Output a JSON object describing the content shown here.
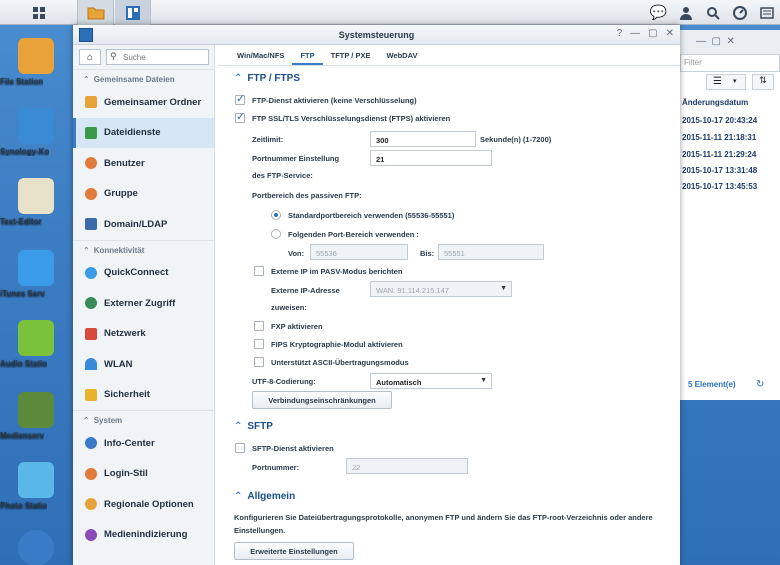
{
  "desktop": {
    "icons": [
      {
        "label": "File Station",
        "color": "#e8a23a"
      },
      {
        "label": "Synology-Ko",
        "color": "#3a8bd6"
      },
      {
        "label": "Text-Editor",
        "color": "#e8e2c8"
      },
      {
        "label": "iTunes Serv",
        "color": "#3a9be8"
      },
      {
        "label": "Audio Statio",
        "color": "#7ac23a"
      },
      {
        "label": "Medienserv",
        "color": "#5a8a3a"
      },
      {
        "label": "Photo Statio",
        "color": "#5ab8e8"
      },
      {
        "label": "",
        "color": "#3a7bc8"
      }
    ]
  },
  "file_station": {
    "filter_placeholder": "Filter",
    "column_header": "Änderungsdatum",
    "rows": [
      "2015-10-17 20:43:24",
      "2015-11-11 21:18:31",
      "2015-11-11 21:29:24",
      "2015-10-17 13:31:48",
      "2015-10-17 13:45:53"
    ],
    "footer": "5 Element(e)"
  },
  "window": {
    "title": "Systemsteuerung",
    "search_placeholder": "Suche"
  },
  "sidebar": {
    "sections": [
      {
        "title": "Gemeinsame Dateien",
        "items": [
          {
            "label": "Gemeinsamer Ordner",
            "icon": "folder-share-icon",
            "color": "#e8a23a"
          },
          {
            "label": "Dateidienste",
            "icon": "file-services-icon",
            "color": "#3a9a4a"
          },
          {
            "label": "Benutzer",
            "icon": "user-icon",
            "color": "#e07a3a"
          },
          {
            "label": "Gruppe",
            "icon": "group-icon",
            "color": "#e07a3a"
          },
          {
            "label": "Domain/LDAP",
            "icon": "domain-icon",
            "color": "#3a6aa8"
          }
        ]
      },
      {
        "title": "Konnektivität",
        "items": [
          {
            "label": "QuickConnect",
            "icon": "quickconnect-icon",
            "color": "#3a9be8"
          },
          {
            "label": "Externer Zugriff",
            "icon": "globe-icon",
            "color": "#3a8a5a"
          },
          {
            "label": "Netzwerk",
            "icon": "network-icon",
            "color": "#d84a3a"
          },
          {
            "label": "WLAN",
            "icon": "wifi-icon",
            "color": "#3a8ad8"
          },
          {
            "label": "Sicherheit",
            "icon": "shield-icon",
            "color": "#e8b22a"
          }
        ]
      },
      {
        "title": "System",
        "items": [
          {
            "label": "Info-Center",
            "icon": "info-icon",
            "color": "#3a7bc8"
          },
          {
            "label": "Login-Stil",
            "icon": "palette-icon",
            "color": "#e07a3a"
          },
          {
            "label": "Regionale Optionen",
            "icon": "regional-icon",
            "color": "#e8a23a"
          },
          {
            "label": "Medienindizierung",
            "icon": "media-index-icon",
            "color": "#8a4ab8"
          }
        ]
      }
    ],
    "selected": "Dateidienste"
  },
  "tabs": [
    "Win/Mac/NFS",
    "FTP",
    "TFTP / PXE",
    "WebDAV"
  ],
  "active_tab": "FTP",
  "ftp": {
    "heading": "FTP / FTPS",
    "enable_ftp": "FTP-Dienst aktivieren (keine Verschlüsselung)",
    "enable_ftps": "FTP SSL/TLS Verschlüsselungsdienst (FTPS) aktivieren",
    "timeout_label": "Zeitlimit:",
    "timeout_value": "300",
    "timeout_unit": "Sekunde(n) (1-7200)",
    "port_label_1": "Portnummer Einstellung",
    "port_label_2": "des FTP-Service:",
    "port_value": "21",
    "passive_label": "Portbereich des passiven FTP:",
    "passive_default": "Standardportbereich verwenden (55536-55551)",
    "passive_custom": "Folgenden Port-Bereich verwenden :",
    "from_label": "Von:",
    "from_value": "55536",
    "to_label": "Bis:",
    "to_value": "55551",
    "report_ext_ip": "Externe IP im PASV-Modus berichten",
    "ext_ip_label_1": "Externe IP-Adresse",
    "ext_ip_label_2": "zuweisen:",
    "ext_ip_value": "WAN: 91.114.215.147",
    "fxp": "FXP aktivieren",
    "fips": "FIPS Kryptographie-Modul aktivieren",
    "ascii": "Unterstützt ASCII-Übertragungsmodus",
    "utf8_label": "UTF-8-Codierung:",
    "utf8_value": "Automatisch",
    "conn_limits_button": "Verbindungseinschränkungen"
  },
  "sftp": {
    "heading": "SFTP",
    "enable": "SFTP-Dienst aktivieren",
    "port_label": "Portnummer:",
    "port_value": "22"
  },
  "general": {
    "heading": "Allgemein",
    "text": "Konfigurieren Sie Dateiübertragungsprotokolle, anonymen FTP und ändern Sie das FTP-root-Verzeichnis oder andere Einstellungen.",
    "advanced_button": "Erweiterte Einstellungen"
  }
}
